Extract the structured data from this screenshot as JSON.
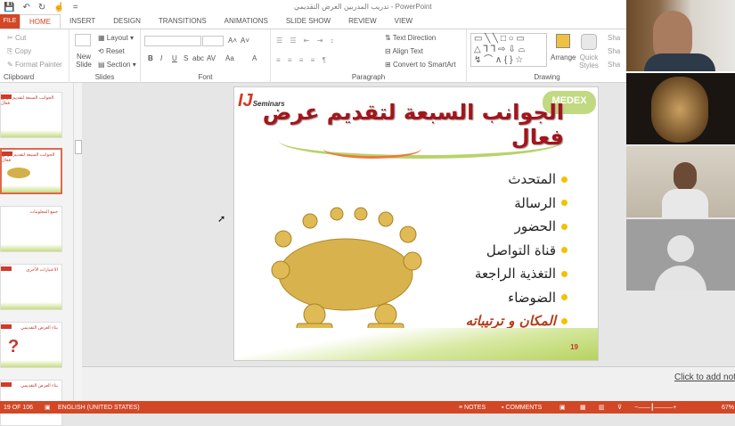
{
  "window": {
    "title": "تدريب المدربين العرض التقديمي - PowerPoint"
  },
  "qat": {
    "save": "💾",
    "undo": "↶",
    "redo": "↻",
    "touch": "☝",
    "more": "="
  },
  "tabs": [
    "FILE",
    "HOME",
    "INSERT",
    "DESIGN",
    "TRANSITIONS",
    "ANIMATIONS",
    "SLIDE SHOW",
    "REVIEW",
    "VIEW"
  ],
  "ribbon": {
    "clipboard": {
      "label": "Clipboard",
      "cut": "Cut",
      "copy": "Copy",
      "format_painter": "Format Painter"
    },
    "slides": {
      "label": "Slides",
      "new_slide": "New Slide",
      "layout": "Layout",
      "reset": "Reset",
      "section": "Section"
    },
    "font": {
      "label": "Font",
      "bold": "B",
      "italic": "I",
      "underline": "U",
      "strike": "S",
      "abc": "abc",
      "spacing": "AV",
      "case": "Aa",
      "color": "A",
      "grow": "A˄",
      "shrink": "A˅"
    },
    "paragraph": {
      "label": "Paragraph",
      "text_direction": "Text Direction",
      "align_text": "Align Text",
      "convert_smartart": "Convert to SmartArt"
    },
    "drawing": {
      "label": "Drawing",
      "arrange": "Arrange",
      "quick_styles": "Quick Styles",
      "shape_fill": "Sha",
      "shape_outline": "Sha",
      "shape_effects": "Sha"
    }
  },
  "slide": {
    "title": "الجوانب السبعة لتقديم عرض فعال",
    "logo": "IJ",
    "logo_sub": "Seminars",
    "brand": "MEDEX",
    "bullets": [
      "المتحدث",
      "الرسالة",
      "الحضور",
      "قناة التواصل",
      "التغذية الراجعة",
      "الضوضاء",
      "المكان و ترتيباته"
    ],
    "page_number": "19"
  },
  "thumbnails": [
    {
      "title": "الجوانب السبعة لتقديم عرض فعال"
    },
    {
      "title": "الجوانب السبعة لتقديم عرض فعال"
    },
    {
      "title": "جمع المعلومات"
    },
    {
      "title": "الاعتبارات الأخرى"
    },
    {
      "title": "بناء العرض التقديمي"
    },
    {
      "title": "بناء العرض التقديمي"
    }
  ],
  "notes": {
    "placeholder": "Click to add notes"
  },
  "status": {
    "slide_count": "19 OF 106",
    "language": "ENGLISH (UNITED STATES)",
    "notes": "NOTES",
    "comments": "COMMENTS",
    "zoom": "67%"
  },
  "colors": {
    "accent": "#d24726",
    "title": "#a3151b",
    "bullet": "#f2c200"
  }
}
